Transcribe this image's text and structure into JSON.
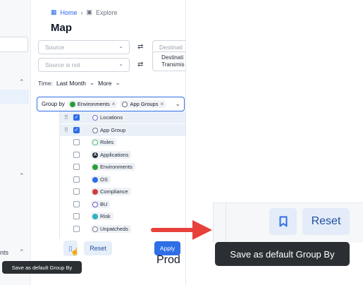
{
  "breadcrumb": {
    "home": "Home",
    "current": "Explore"
  },
  "page": {
    "title": "Map"
  },
  "filters": {
    "source_placeholder": "Source",
    "source_is_not_placeholder": "Source is not",
    "destination_placeholder": "Destinati",
    "destination_transmission": [
      "Destinati",
      "Transmis"
    ]
  },
  "time": {
    "label": "Time:",
    "value": "Last Month",
    "more": "More"
  },
  "group_by": {
    "label": "Group by",
    "chips": [
      {
        "label": "Environments",
        "color": "#2a9d3a"
      },
      {
        "label": "App Groups",
        "color": "#6b7280"
      }
    ],
    "options": [
      {
        "label": "Locations",
        "checked": true,
        "color": "#7c6bd6",
        "glyph": ""
      },
      {
        "label": "App Group",
        "checked": true,
        "color": "#6b7280",
        "glyph": ""
      },
      {
        "label": "Roles",
        "checked": false,
        "color": "#4fbf6b",
        "glyph": ""
      },
      {
        "label": "Applications",
        "checked": false,
        "color": "#1f2937",
        "glyph": "A"
      },
      {
        "label": "Environments",
        "checked": false,
        "color": "#2a9d3a",
        "glyph": ""
      },
      {
        "label": "OS",
        "checked": false,
        "color": "#2e6ee6",
        "glyph": ""
      },
      {
        "label": "Compliance",
        "checked": false,
        "color": "#d23b3b",
        "glyph": ""
      },
      {
        "label": "BU",
        "checked": false,
        "color": "#6d5bd0",
        "glyph": ""
      },
      {
        "label": "Risk",
        "checked": false,
        "color": "#2bb3c0",
        "glyph": ""
      },
      {
        "label": "Unpatcheds",
        "checked": false,
        "color": "#7a7f87",
        "glyph": ""
      }
    ]
  },
  "footer": {
    "reset": "Reset",
    "apply": "Apply"
  },
  "tooltip": {
    "text": "Save as default Group By"
  },
  "sidebar": {
    "partial_label": "nts"
  },
  "background_text": "Prod",
  "zoom": {
    "reset": "Reset",
    "tooltip": "Save as default Group By"
  },
  "colors": {
    "accent": "#2e6ee6",
    "arrow": "#e8403a",
    "tooltip_bg": "#2b2f33"
  }
}
